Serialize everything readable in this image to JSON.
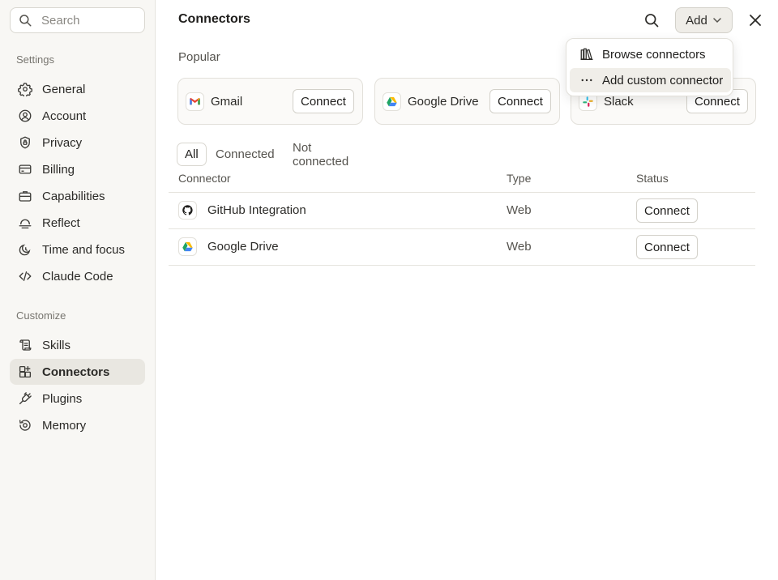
{
  "search": {
    "placeholder": "Search"
  },
  "sidebar": {
    "settings_label": "Settings",
    "settings_items": [
      {
        "label": "General",
        "icon": "gear-icon"
      },
      {
        "label": "Account",
        "icon": "user-circle-icon"
      },
      {
        "label": "Privacy",
        "icon": "shield-icon"
      },
      {
        "label": "Billing",
        "icon": "credit-card-icon"
      },
      {
        "label": "Capabilities",
        "icon": "briefcase-icon"
      },
      {
        "label": "Reflect",
        "icon": "reflect-icon"
      },
      {
        "label": "Time and focus",
        "icon": "moon-clock-icon"
      },
      {
        "label": "Claude Code",
        "icon": "code-icon"
      }
    ],
    "customize_label": "Customize",
    "customize_items": [
      {
        "label": "Skills",
        "icon": "scroll-icon"
      },
      {
        "label": "Connectors",
        "icon": "grid-plus-icon",
        "active": true
      },
      {
        "label": "Plugins",
        "icon": "plug-icon"
      },
      {
        "label": "Memory",
        "icon": "memory-icon"
      }
    ]
  },
  "header": {
    "title": "Connectors",
    "add_label": "Add"
  },
  "popular": {
    "label": "Popular",
    "cards": [
      {
        "name": "Gmail",
        "button": "Connect",
        "icon": "gmail-icon"
      },
      {
        "name": "Google Drive",
        "button": "Connect",
        "icon": "google-drive-icon"
      },
      {
        "name": "Slack",
        "button": "Connect",
        "icon": "slack-icon"
      }
    ]
  },
  "tabs": [
    "All",
    "Connected",
    "Not connected"
  ],
  "table": {
    "headers": {
      "connector": "Connector",
      "type": "Type",
      "status": "Status"
    },
    "rows": [
      {
        "name": "GitHub Integration",
        "type": "Web",
        "button": "Connect",
        "icon": "github-icon"
      },
      {
        "name": "Google Drive",
        "type": "Web",
        "button": "Connect",
        "icon": "google-drive-icon"
      }
    ]
  },
  "dropdown": {
    "items": [
      {
        "label": "Browse connectors",
        "icon": "library-icon"
      },
      {
        "label": "Add custom connector",
        "icon": "more-horizontal-icon"
      }
    ]
  },
  "colors": {
    "sidebar_bg": "#f8f7f4",
    "active_nav_bg": "#e9e7e1",
    "text_primary": "#2b2a27",
    "border": "#d3d1ca"
  }
}
